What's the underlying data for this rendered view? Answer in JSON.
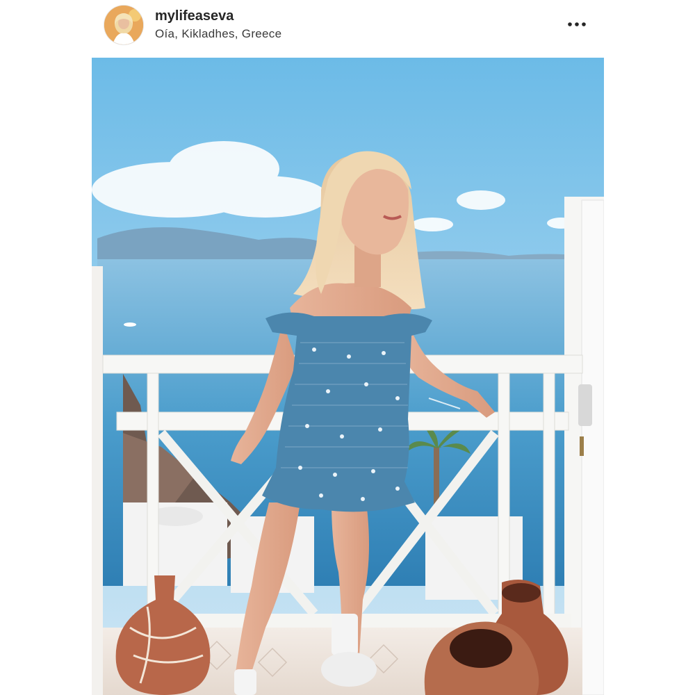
{
  "post": {
    "username": "mylifeaseva",
    "location": "Oía, Kikladhes, Greece",
    "more_icon": "more-horizontal-icon",
    "avatar_alt": "mylifeaseva profile picture",
    "photo_alt": "Woman in a blue smocked floral off-shoulder dress posing on a white balcony overlooking the sea in Oia, Santorini"
  },
  "colors": {
    "username_text": "#262626",
    "location_text": "#3a3a3a",
    "sky_top": "#69b9e6",
    "sea": "#3f93c6",
    "dress": "#4b86ad",
    "railing": "#f7f7f5"
  }
}
